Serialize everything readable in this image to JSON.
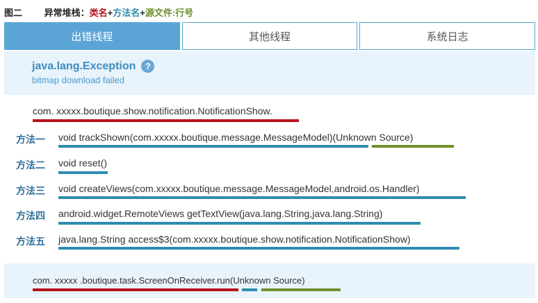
{
  "caption": {
    "figure": "图二",
    "label": "异常堆栈：",
    "class_name": "类名",
    "plus1": "+",
    "method_name": "方法名",
    "plus2": "+",
    "source_line": "源文件:行号"
  },
  "tabs": [
    {
      "label": "出错线程",
      "active": true
    },
    {
      "label": "其他线程",
      "active": false
    },
    {
      "label": "系统日志",
      "active": false
    }
  ],
  "exception": {
    "title": "java.lang.Exception",
    "message": "bitmap download failed",
    "help_icon": "question-circle-icon"
  },
  "stack": {
    "class_line": "com. xxxxx.boutique.show.notification.NotificationShow.",
    "methods": [
      {
        "label": "方法一",
        "text": "void trackShown(com.xxxxx.boutique.message.MessageModel)(Unknown Source)"
      },
      {
        "label": "方法二",
        "text": "void reset()"
      },
      {
        "label": "方法三",
        "text": "void createViews(com.xxxxx.boutique.message.MessageModel,android.os.Handler)"
      },
      {
        "label": "方法四",
        "text": "android.widget.RemoteViews getTextView(java.lang.String,java.lang.String)"
      },
      {
        "label": "方法五",
        "text": "java.lang.String access$3(com.xxxxx.boutique.show.notification.NotificationShow)"
      }
    ],
    "bottom_line": "com. xxxxx .boutique.task.ScreenOnReceiver.run(Unknown Source)"
  },
  "colors": {
    "class_red": "#b8121b",
    "method_blue": "#2e8db0",
    "source_green": "#6e8f2b",
    "tab_active": "#5aa4d6",
    "panel_bg": "#e8f3fb"
  }
}
